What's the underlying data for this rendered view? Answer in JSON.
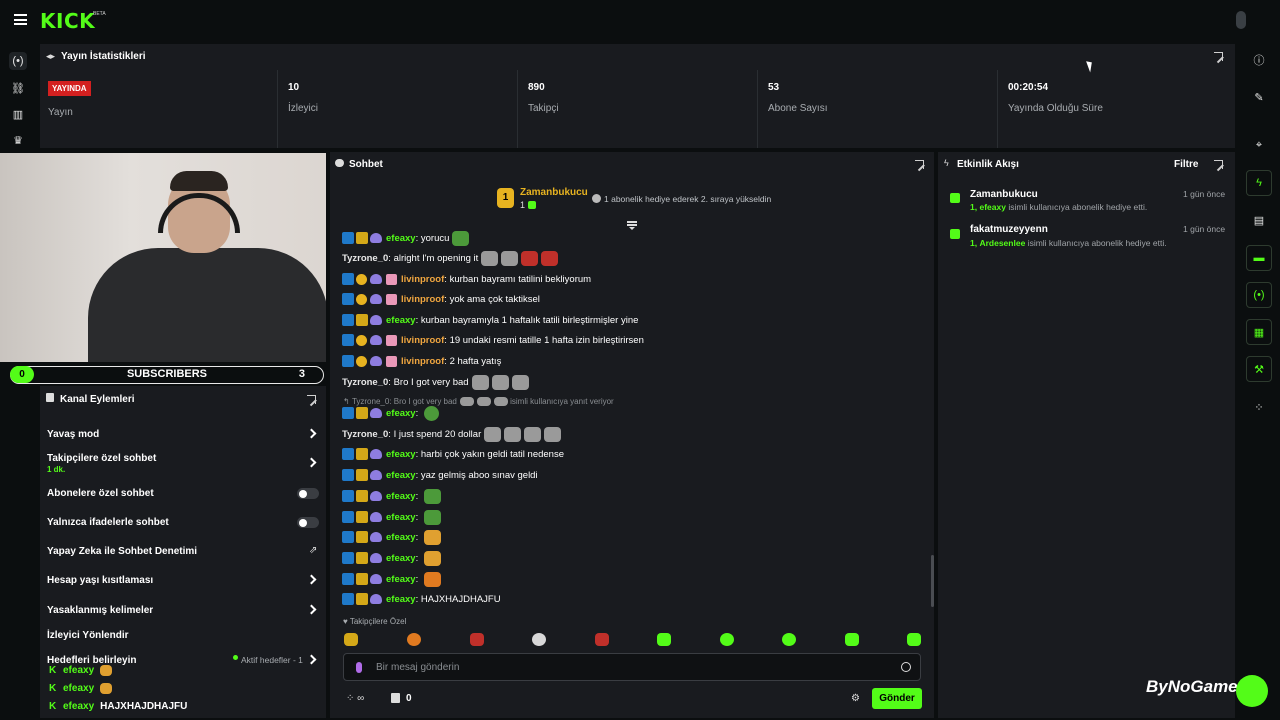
{
  "topbar": {
    "logo": "KICK",
    "logo_beta": "BETA"
  },
  "stats": {
    "title": "Yayın İstatistikleri",
    "live_badge": "YAYINDA",
    "live_label": "Yayın",
    "viewers": {
      "value": "10",
      "label": "İzleyici"
    },
    "followers": {
      "value": "890",
      "label": "Takipçi"
    },
    "subscribers": {
      "value": "53",
      "label": "Abone Sayısı"
    },
    "uptime": {
      "value": "00:20:54",
      "label": "Yayında Olduğu Süre"
    }
  },
  "sub_goal": {
    "left": "0",
    "title": "SUBSCRIBERS",
    "right": "3"
  },
  "channel_actions": {
    "title": "Kanal Eylemleri",
    "slow_mode": "Yavaş mod",
    "followers_only": "Takipçilere özel sohbet",
    "followers_only_sub": "1 dk.",
    "subs_only": "Abonelere özel sohbet",
    "emotes_only": "Yalnızca ifadelerle sohbet",
    "ai_moderation": "Yapay Zeka ile Sohbet Denetimi",
    "account_age": "Hesap yaşı kısıtlaması",
    "banned_words": "Yasaklanmış kelimeler",
    "redirect": "İzleyici Yönlendir",
    "goals": "Hedefleri belirleyin",
    "active_goals": "Aktif hedefler - 1",
    "goal_rows": [
      {
        "user": "efeaxy",
        "msg": ""
      },
      {
        "user": "efeaxy",
        "msg": ""
      },
      {
        "user": "efeaxy",
        "msg": "HAJXHAJDHAJFU"
      }
    ]
  },
  "chat": {
    "title": "Sohbet",
    "pinned_user": "Zamanbukucu",
    "pinned_rank": "1",
    "pinned_count": "1",
    "pinned_message": "1 abonelik hediye ederek 2. sıraya yükseldin",
    "messages": [
      {
        "user": "efeaxy",
        "text": "yorucu"
      },
      {
        "user": "Tyzrone_0",
        "text": "alright I'm opening it"
      },
      {
        "user": "livinproof",
        "text": "kurban bayramı tatilini bekliyorum"
      },
      {
        "user": "livinproof",
        "text": "yok ama çok taktiksel"
      },
      {
        "user": "efeaxy",
        "text": "kurban bayramıyla 1 haftalık tatili birleştirmişler yine"
      },
      {
        "user": "livinproof",
        "text": "19 undaki resmi tatille 1 hafta izin birleştirirsen"
      },
      {
        "user": "livinproof",
        "text": "2 hafta yatış"
      },
      {
        "user": "Tyzrone_0",
        "text": "Bro I got very bad"
      },
      {
        "user": "efeaxy",
        "text": ""
      },
      {
        "user": "Tyzrone_0",
        "text": "I just spend 20 dollar"
      },
      {
        "user": "efeaxy",
        "text": "harbi çok yakın geldi tatil nedense"
      },
      {
        "user": "efeaxy",
        "text": "yaz gelmiş aboo sınav geldi"
      },
      {
        "user": "efeaxy",
        "text": ""
      },
      {
        "user": "efeaxy",
        "text": ""
      },
      {
        "user": "efeaxy",
        "text": ""
      },
      {
        "user": "efeaxy",
        "text": ""
      },
      {
        "user": "efeaxy",
        "text": ""
      },
      {
        "user": "efeaxy",
        "text": "HAJXHAJDHAJFU"
      }
    ],
    "reply_preview": "Tyzrone_0: Bro I got very bad",
    "reply_suffix": "isimli kullanıcıya yanıt veriyor",
    "followers_only_tag": "Takipçilere Özel",
    "input_placeholder": "Bir mesaj gönderin",
    "footer_count": "0",
    "send": "Gönder"
  },
  "activity": {
    "title": "Etkinlik Akışı",
    "filter": "Filtre",
    "events": [
      {
        "name": "Zamanbukucu",
        "time": "1 gün önce",
        "count": "1,",
        "target": "efeaxy",
        "desc": "isimli kullanıcıya abonelik hediye etti."
      },
      {
        "name": "fakatmuzeyyenn",
        "time": "1 gün önce",
        "count": "1,",
        "target": "Ardesenlee",
        "desc": "isimli kullanıcıya abonelik hediye etti."
      }
    ]
  },
  "watermark": "ByNoGame",
  "colors": {
    "accent": "#53fc18",
    "live": "#d32020",
    "panel": "#191b1f",
    "background": "#0b0e0f"
  }
}
